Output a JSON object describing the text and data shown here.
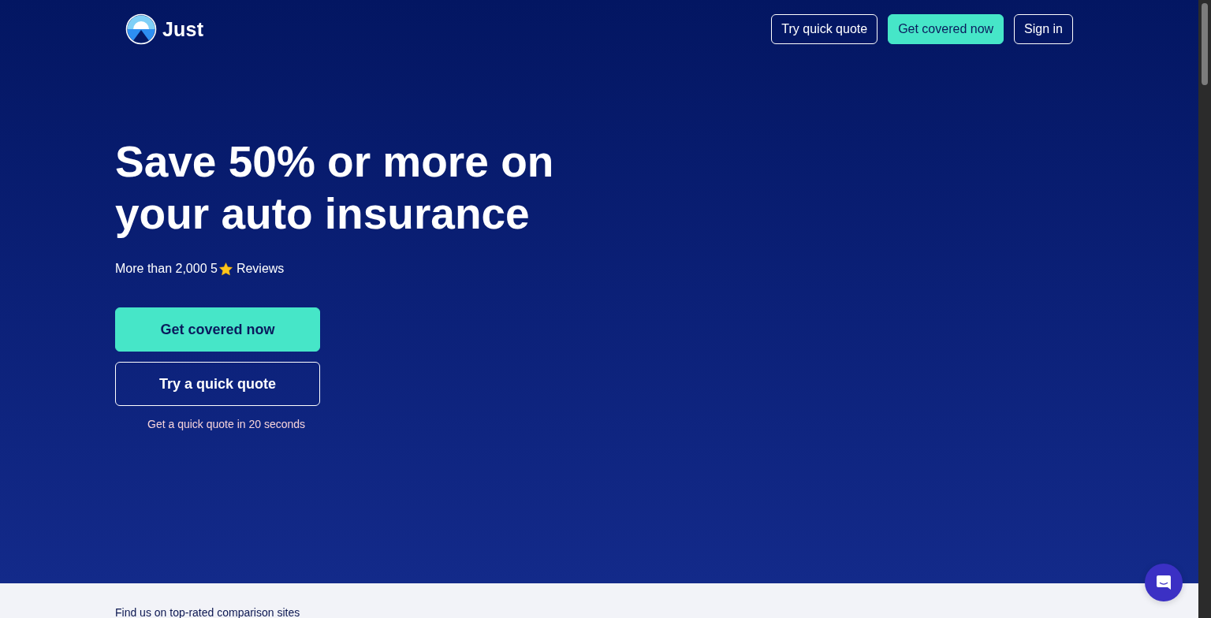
{
  "header": {
    "logo": {
      "text": "Just"
    },
    "nav_buttons": [
      {
        "label": "Try quick quote",
        "kind": "outline"
      },
      {
        "label": "Get covered now",
        "kind": "filled"
      },
      {
        "label": "Sign in",
        "kind": "outline"
      }
    ]
  },
  "hero": {
    "heading": "Save 50% or more on your auto insurance",
    "reviews": {
      "before": "More than 2,000 5",
      "after": "Reviews"
    },
    "buttons": [
      {
        "label": "Get covered now",
        "kind": "filled"
      },
      {
        "label": "Try a quick quote",
        "kind": "outline"
      }
    ],
    "caption": "Get a quick quote in 20 seconds"
  },
  "comparison": {
    "title": "Find us on top-rated comparison sites"
  }
}
